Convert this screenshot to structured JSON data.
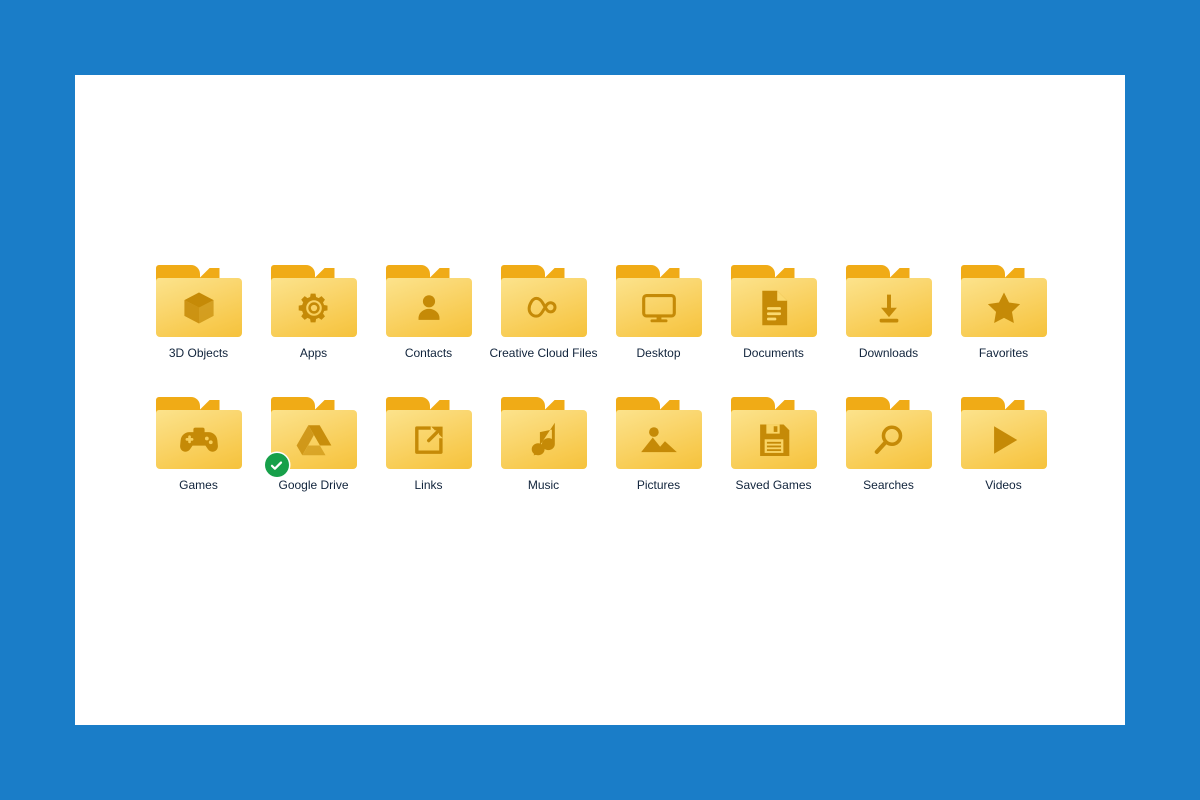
{
  "window": {
    "background_color": "#1a7dc8",
    "panel_color": "#ffffff"
  },
  "theme": {
    "folder_tab_color": "#f0ab16",
    "folder_body_light": "#fce38c",
    "folder_body_dark": "#f5c23c",
    "glyph_color": "#c58a07",
    "label_color": "#10233b",
    "badge_color": "#17a04a",
    "badge_check_color": "#ffffff"
  },
  "icon_grid": {
    "columns": 8,
    "rows": 2,
    "items": [
      {
        "label": "3D Objects",
        "icon": "cube-icon",
        "badge": null
      },
      {
        "label": "Apps",
        "icon": "gear-icon",
        "badge": null
      },
      {
        "label": "Contacts",
        "icon": "person-icon",
        "badge": null
      },
      {
        "label": "Creative Cloud Files",
        "icon": "creative-cloud-icon",
        "badge": null
      },
      {
        "label": "Desktop",
        "icon": "monitor-icon",
        "badge": null
      },
      {
        "label": "Documents",
        "icon": "document-icon",
        "badge": null
      },
      {
        "label": "Downloads",
        "icon": "download-arrow-icon",
        "badge": null
      },
      {
        "label": "Favorites",
        "icon": "star-icon",
        "badge": null
      },
      {
        "label": "Games",
        "icon": "gamepad-icon",
        "badge": null
      },
      {
        "label": "Google Drive",
        "icon": "google-drive-icon",
        "badge": "sync-complete-check-badge"
      },
      {
        "label": "Links",
        "icon": "external-link-icon",
        "badge": null
      },
      {
        "label": "Music",
        "icon": "music-note-icon",
        "badge": null
      },
      {
        "label": "Pictures",
        "icon": "picture-mountain-icon",
        "badge": null
      },
      {
        "label": "Saved Games",
        "icon": "floppy-disk-icon",
        "badge": null
      },
      {
        "label": "Searches",
        "icon": "magnifier-icon",
        "badge": null
      },
      {
        "label": "Videos",
        "icon": "play-triangle-icon",
        "badge": null
      }
    ]
  }
}
